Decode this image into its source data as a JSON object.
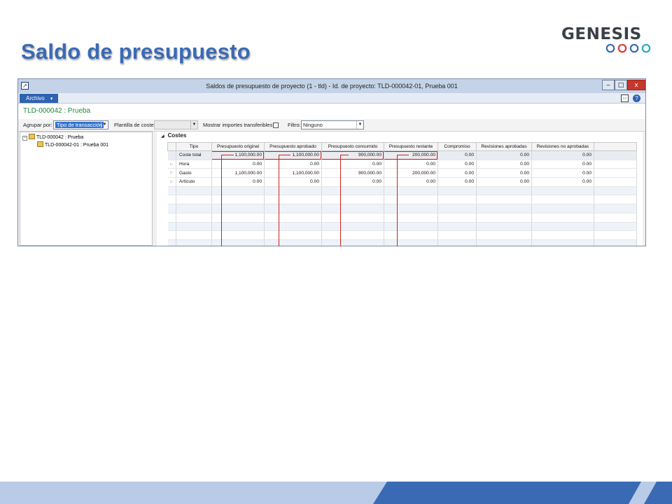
{
  "slide": {
    "title": "Saldo de presupuesto",
    "logo_text": "GENESIS",
    "colors": {
      "title": "#3a6ab4",
      "accent": "#2f62b0",
      "highlight": "#d41f1f",
      "project_title": "#1d8a3a"
    }
  },
  "window": {
    "title": "Saldos de presupuesto de proyecto (1 - tld) - Id. de proyecto: TLD-000042-01, Prueba 001",
    "controls": {
      "minimize": "‒",
      "maximize": "□",
      "close": "x"
    }
  },
  "menu": {
    "archivo_label": "Archivo",
    "archivo_arrow": "▾",
    "help_icon": "?"
  },
  "project_header": {
    "title": "TLD-000042 : Prueba"
  },
  "filters": {
    "agrupar_label": "Agrupar por:",
    "agrupar_value": "Tipo de transacción",
    "plantilla_label": "Plantilla de coste:",
    "plantilla_value": "",
    "mostrar_label": "Mostrar importes transferibles:",
    "mostrar_checked": false,
    "filtro_label": "Filtro:",
    "filtro_value": "Ninguno"
  },
  "tree": {
    "root": {
      "label": "TLD-000042 : Prueba",
      "toggle": "−"
    },
    "child": {
      "label": "TLD-000042-01 : Prueba 001"
    }
  },
  "section": {
    "title": "Costes",
    "arrow": "◢"
  },
  "grid": {
    "columns": [
      "Tipo",
      "Presupuesto original",
      "Presupuesto aprobado",
      "Presupuesto consumido",
      "Presupuesto restante",
      "Compromiso",
      "Revisiones aprobadas",
      "Revisiones no aprobadas"
    ],
    "rows": [
      {
        "tipo": "Coste total",
        "values": [
          "1,100,000.00",
          "1,100,000.00",
          "900,000.00",
          "200,000.00",
          "0.00",
          "0.00",
          "0.00"
        ],
        "expandable": false
      },
      {
        "tipo": "Hora",
        "values": [
          "0.00",
          "0.00",
          "0.00",
          "0.00",
          "0.00",
          "0.00",
          "0.00"
        ],
        "expandable": true
      },
      {
        "tipo": "Gasto",
        "values": [
          "1,100,000.00",
          "1,100,000.00",
          "900,000.00",
          "200,000.00",
          "0.00",
          "0.00",
          "0.00"
        ],
        "expandable": true
      },
      {
        "tipo": "Artículo",
        "values": [
          "0.00",
          "0.00",
          "0.00",
          "0.00",
          "0.00",
          "0.00",
          "0.00"
        ],
        "expandable": true
      }
    ],
    "expand_glyph": "▷"
  }
}
